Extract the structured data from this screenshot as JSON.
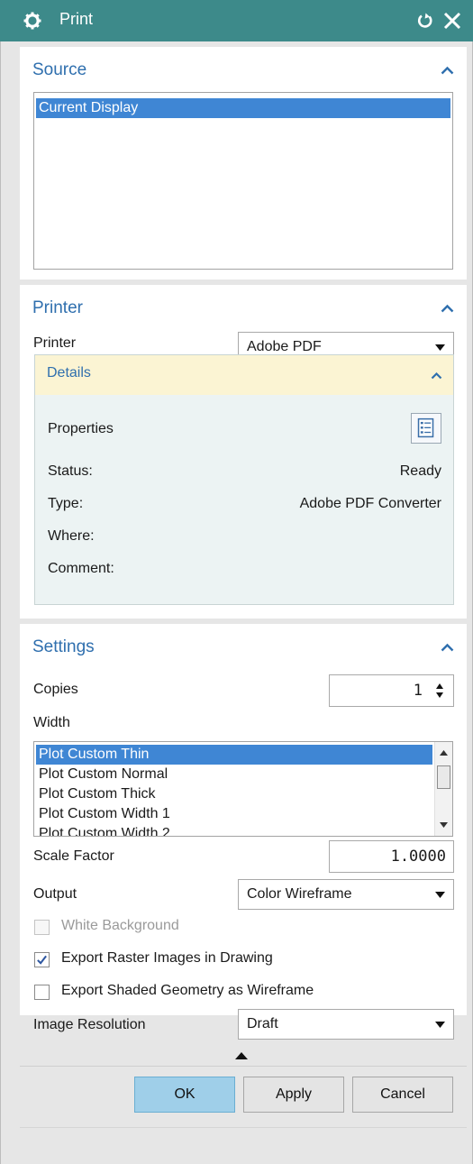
{
  "window": {
    "title": "Print"
  },
  "source": {
    "title": "Source",
    "items": [
      "Current Display"
    ],
    "selected_index": 0
  },
  "printer": {
    "title": "Printer",
    "printer_label": "Printer",
    "printer_value": "Adobe PDF",
    "details": {
      "title": "Details",
      "properties_label": "Properties",
      "status_label": "Status:",
      "status_value": "Ready",
      "type_label": "Type:",
      "type_value": "Adobe PDF Converter",
      "where_label": "Where:",
      "where_value": "",
      "comment_label": "Comment:",
      "comment_value": ""
    }
  },
  "settings": {
    "title": "Settings",
    "copies_label": "Copies",
    "copies_value": "1",
    "width_label": "Width",
    "width_items": [
      "Plot Custom Thin",
      "Plot Custom Normal",
      "Plot Custom Thick",
      "Plot Custom Width 1",
      "Plot Custom Width 2"
    ],
    "width_selected_index": 0,
    "scale_factor_label": "Scale Factor",
    "scale_factor_value": "1.0000",
    "output_label": "Output",
    "output_value": "Color Wireframe",
    "white_background_label": "White Background",
    "white_background_checked": false,
    "white_background_enabled": false,
    "export_raster_label": "Export Raster Images in Drawing",
    "export_raster_checked": true,
    "export_shaded_label": "Export Shaded Geometry as Wireframe",
    "export_shaded_checked": false,
    "image_resolution_label": "Image Resolution",
    "image_resolution_value": "Draft"
  },
  "buttons": {
    "ok": "OK",
    "apply": "Apply",
    "cancel": "Cancel"
  },
  "colors": {
    "titlebar": "#3d8a8a",
    "section_title": "#2f6fae",
    "selection": "#3f86d4",
    "details_header": "#fbf4d3",
    "ok_button": "#9fcfe9"
  },
  "icons": {
    "title": "gear-icon",
    "reset": "reset-icon",
    "close": "close-icon",
    "collapse": "chevron-up-icon",
    "dropdown": "triangle-down-icon",
    "properties": "properties-list-icon"
  }
}
